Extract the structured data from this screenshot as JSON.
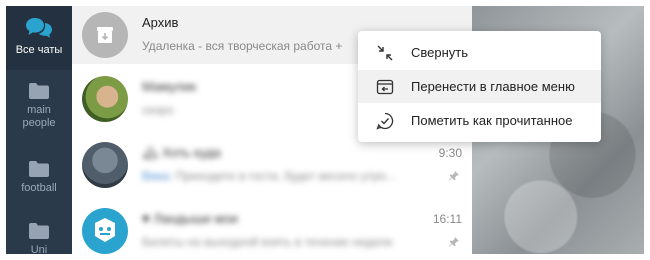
{
  "folders": [
    {
      "label": "Все чаты",
      "icon": "chats-icon",
      "active": true
    },
    {
      "label": "main\npeople",
      "icon": "folder-icon"
    },
    {
      "label": "football",
      "icon": "folder-icon"
    },
    {
      "label": "Uni",
      "icon": "folder-icon"
    }
  ],
  "archive": {
    "title": "Архив",
    "subtitle": "Удаленка - вся творческая работа +",
    "icon": "archive-box-icon"
  },
  "chats": [
    {
      "name": "Мамулик",
      "preview": "скоро",
      "time": "",
      "pinned": false
    },
    {
      "name": "🏔 Хоть куда",
      "sender": "Вика:",
      "preview": "Приходите в гости, будет весело утро...",
      "time": "9:30",
      "pinned": true
    },
    {
      "name": "♥ Ландыши мои",
      "preview": "Билеты на выходной взять в течение недели",
      "time": "16:11",
      "pinned": true
    }
  ],
  "context_menu": {
    "items": [
      {
        "label": "Свернуть",
        "icon": "collapse-arrows-icon"
      },
      {
        "label": "Перенести в главное меню",
        "icon": "move-to-main-icon",
        "highlighted": true
      },
      {
        "label": "Пометить как прочитанное",
        "icon": "check-circle-icon"
      }
    ]
  },
  "colors": {
    "rail": "#2b3a4a",
    "rail_active": "#233140",
    "accent": "#2aa4cf",
    "menu_hover": "#f1f1f1"
  }
}
